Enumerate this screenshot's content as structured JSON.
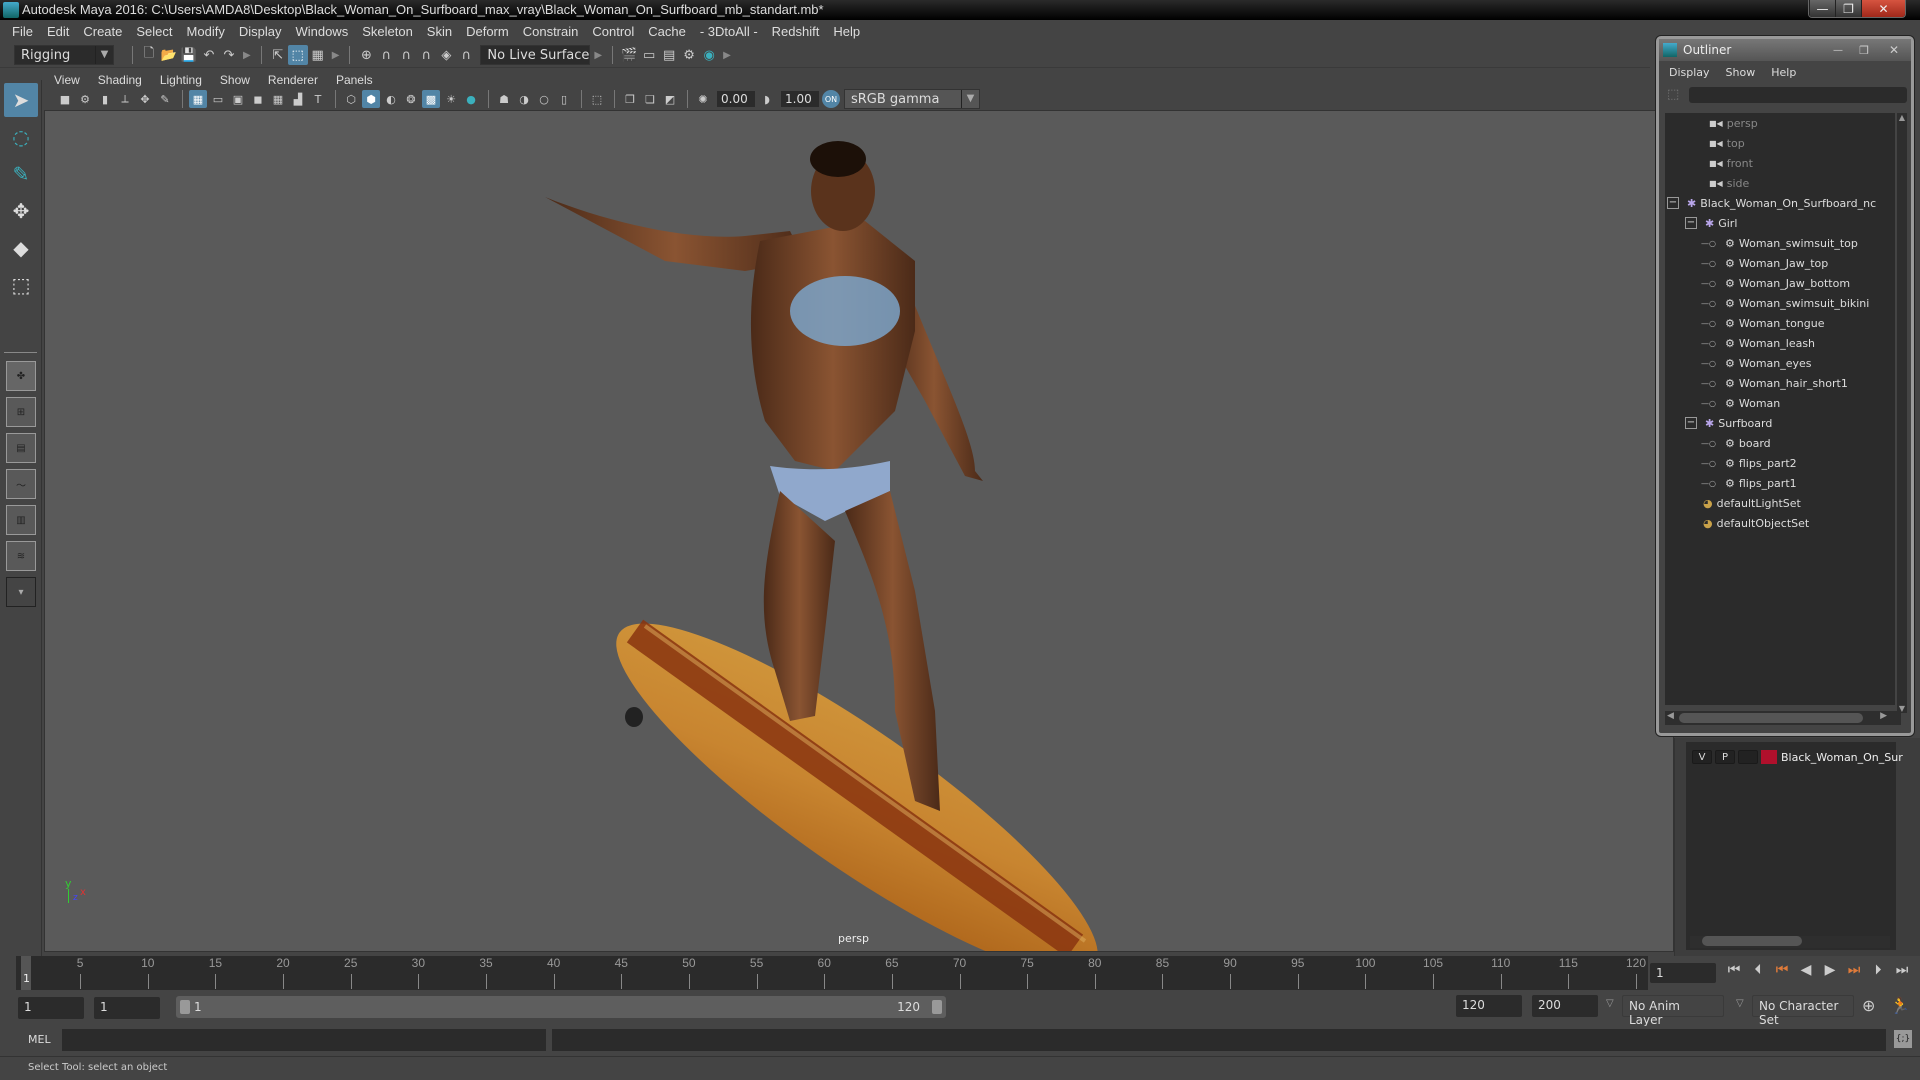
{
  "window": {
    "title": "Autodesk Maya 2016: C:\\Users\\AMDA8\\Desktop\\Black_Woman_On_Surfboard_max_vray\\Black_Woman_On_Surfboard_mb_standart.mb*",
    "minimize": "—",
    "maximize": "❐",
    "close": "✕"
  },
  "menubar": [
    "File",
    "Edit",
    "Create",
    "Select",
    "Modify",
    "Display",
    "Windows",
    "Skeleton",
    "Skin",
    "Deform",
    "Constrain",
    "Control",
    "Cache",
    "- 3DtoAll -",
    "Redshift",
    "Help"
  ],
  "shelf": {
    "mode": "Rigging",
    "live_surface": "No Live Surface",
    "icons": [
      "new-scene-icon",
      "open-scene-icon",
      "save-scene-icon",
      "undo-icon",
      "redo-icon",
      "select-hierarchy-icon",
      "select-object-icon",
      "select-component-icon",
      "snap-grid-icon",
      "snap-curve-icon",
      "snap-point-icon",
      "snap-view-plane-icon",
      "snap-surface-icon",
      "make-live-icon",
      "render-view-icon",
      "render-frame-icon",
      "ipr-render-icon",
      "render-settings-icon",
      "hypershade-icon"
    ]
  },
  "panel_menu": [
    "View",
    "Shading",
    "Lighting",
    "Show",
    "Renderer",
    "Panels"
  ],
  "panel_toolbar": {
    "exposure": "0.00",
    "gamma": "1.00",
    "color_space": "sRGB gamma"
  },
  "viewport": {
    "camera_label": "persp",
    "axis": {
      "y": "y",
      "x": "x",
      "z": "z"
    }
  },
  "toolbox": [
    "select-tool",
    "lasso-tool",
    "paint-select-tool",
    "move-tool",
    "rotate-tool",
    "scale-tool"
  ],
  "timeline": {
    "ticks": [
      5,
      10,
      15,
      20,
      25,
      30,
      35,
      40,
      45,
      50,
      55,
      60,
      65,
      70,
      75,
      80,
      85,
      90,
      95,
      100,
      105,
      110,
      115,
      120
    ],
    "start": 1,
    "end": 120,
    "current_marker": "1",
    "current_frame": "1"
  },
  "range": {
    "start_time": "1",
    "playback_start": "1",
    "slider_start": "1",
    "slider_end": "120",
    "playback_end": "120",
    "end_time": "200",
    "anim_layer": "No Anim Layer",
    "character_set": "No Character Set"
  },
  "command_line": {
    "label": "MEL",
    "value": "",
    "result": ""
  },
  "status": "Select Tool: select an object",
  "outliner": {
    "title": "Outliner",
    "menu": [
      "Display",
      "Show",
      "Help"
    ],
    "filter": "",
    "items": [
      {
        "label": "persp",
        "type": "camera",
        "depth": 0
      },
      {
        "label": "top",
        "type": "camera",
        "depth": 0
      },
      {
        "label": "front",
        "type": "camera",
        "depth": 0
      },
      {
        "label": "side",
        "type": "camera",
        "depth": 0
      },
      {
        "label": "Black_Woman_On_Surfboard_nc",
        "type": "group",
        "depth": 0,
        "expanded": true
      },
      {
        "label": "Girl",
        "type": "group",
        "depth": 1,
        "expanded": true
      },
      {
        "label": "Woman_swimsuit_top",
        "type": "mesh",
        "depth": 2
      },
      {
        "label": "Woman_Jaw_top",
        "type": "mesh",
        "depth": 2
      },
      {
        "label": "Woman_Jaw_bottom",
        "type": "mesh",
        "depth": 2
      },
      {
        "label": "Woman_swimsuit_bikini",
        "type": "mesh",
        "depth": 2
      },
      {
        "label": "Woman_tongue",
        "type": "mesh",
        "depth": 2
      },
      {
        "label": "Woman_leash",
        "type": "mesh",
        "depth": 2
      },
      {
        "label": "Woman_eyes",
        "type": "mesh",
        "depth": 2
      },
      {
        "label": "Woman_hair_short1",
        "type": "mesh",
        "depth": 2
      },
      {
        "label": "Woman",
        "type": "mesh",
        "depth": 2
      },
      {
        "label": "Surfboard",
        "type": "group",
        "depth": 1,
        "expanded": true
      },
      {
        "label": "board",
        "type": "mesh",
        "depth": 2
      },
      {
        "label": "flips_part2",
        "type": "mesh",
        "depth": 2
      },
      {
        "label": "flips_part1",
        "type": "mesh",
        "depth": 2
      },
      {
        "label": "defaultLightSet",
        "type": "set",
        "depth": 0
      },
      {
        "label": "defaultObjectSet",
        "type": "set",
        "depth": 0
      }
    ]
  },
  "layers": [
    {
      "visible": "V",
      "playback": "P",
      "color": "#b0102c",
      "name": "Black_Woman_On_Sur"
    }
  ]
}
